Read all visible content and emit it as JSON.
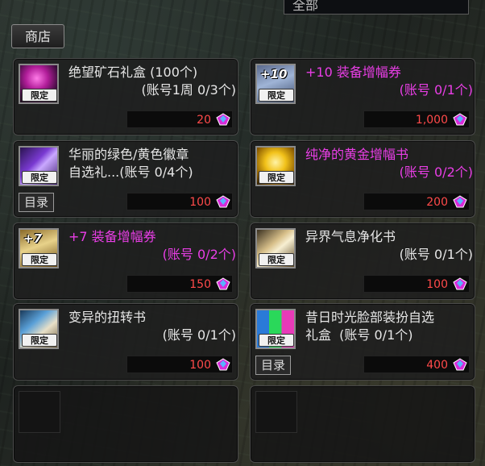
{
  "header": {
    "filter_value": "全部",
    "shop_tab_label": "商店"
  },
  "items": [
    {
      "name_line1": "绝望矿石礼盒 (100个)",
      "name_line2": "",
      "limit": "(账号1周 0/3个)",
      "price": "20",
      "color": "white",
      "plus": "",
      "badge": "限定",
      "icon": "magenta-box-icon",
      "catalog": ""
    },
    {
      "name_line1": "+10 装备增幅券",
      "name_line2": "",
      "limit": "(账号 0/1个)",
      "price": "1,000",
      "color": "magenta",
      "plus": "+10",
      "badge": "限定",
      "icon": "amplify-ticket-icon",
      "catalog": ""
    },
    {
      "name_line1": "华丽的绿色/黄色徽章",
      "name_line2": "自选礼...(账号 0/4个)",
      "limit": "",
      "price": "100",
      "color": "white",
      "plus": "",
      "badge": "限定",
      "icon": "emblem-box-icon",
      "catalog": "目录"
    },
    {
      "name_line1": "纯净的黄金增幅书",
      "name_line2": "",
      "limit": "(账号 0/2个)",
      "price": "200",
      "color": "magenta",
      "plus": "",
      "badge": "限定",
      "icon": "gold-book-icon",
      "catalog": ""
    },
    {
      "name_line1": "+7 装备增幅券",
      "name_line2": "",
      "limit": "(账号 0/2个)",
      "price": "150",
      "color": "magenta",
      "plus": "+7",
      "badge": "限定",
      "icon": "amplify-ticket-icon",
      "catalog": ""
    },
    {
      "name_line1": "异界气息净化书",
      "name_line2": "",
      "limit": "(账号 0/1个)",
      "price": "100",
      "color": "white",
      "plus": "",
      "badge": "限定",
      "icon": "purify-book-icon",
      "catalog": ""
    },
    {
      "name_line1": "变异的扭转书",
      "name_line2": "",
      "limit": "(账号 0/1个)",
      "price": "100",
      "color": "white",
      "plus": "",
      "badge": "限定",
      "icon": "twist-book-icon",
      "catalog": ""
    },
    {
      "name_line1": "昔日时光脸部装扮自选",
      "name_line2": "礼盒  (账号 0/1个)",
      "limit": "",
      "price": "400",
      "color": "white",
      "plus": "",
      "badge": "限定",
      "icon": "face-box-icon",
      "catalog": "目录"
    }
  ],
  "colors": {
    "price_text": "#ff4a4a",
    "magenta_name": "#e93ee6",
    "white_name": "#e6e6e6"
  }
}
